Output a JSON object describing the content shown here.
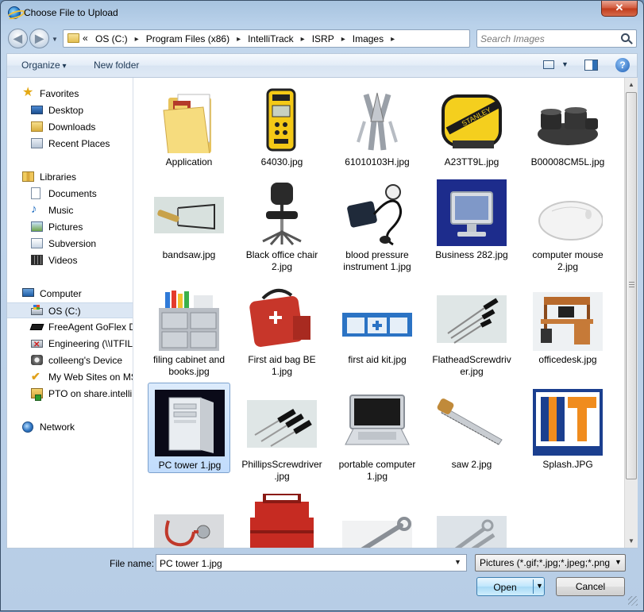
{
  "window": {
    "title": "Choose File to Upload",
    "close_label": "✕"
  },
  "nav": {
    "back_label": "◀",
    "forward_label": "▶",
    "refresh_label": "⟲"
  },
  "address": {
    "lead": "«",
    "crumbs": [
      "OS (C:)",
      "Program Files (x86)",
      "IntelliTrack",
      "ISRP",
      "Images"
    ],
    "separator": "▸"
  },
  "search": {
    "placeholder": "Search Images",
    "value": ""
  },
  "toolbar": {
    "organize_label": "Organize",
    "new_folder_label": "New folder",
    "help_label": "?"
  },
  "sidebar": {
    "groups": [
      {
        "label": "Favorites",
        "icon": "star-icon",
        "items": [
          {
            "label": "Desktop",
            "icon": "desktop-icon"
          },
          {
            "label": "Downloads",
            "icon": "downloads-folder-icon"
          },
          {
            "label": "Recent Places",
            "icon": "recent-places-icon"
          }
        ]
      },
      {
        "label": "Libraries",
        "icon": "libraries-icon",
        "items": [
          {
            "label": "Documents",
            "icon": "documents-icon"
          },
          {
            "label": "Music",
            "icon": "music-icon"
          },
          {
            "label": "Pictures",
            "icon": "pictures-icon"
          },
          {
            "label": "Subversion",
            "icon": "subversion-icon"
          },
          {
            "label": "Videos",
            "icon": "videos-icon"
          }
        ]
      },
      {
        "label": "Computer",
        "icon": "computer-icon",
        "items": [
          {
            "label": "OS (C:)",
            "icon": "drive-icon",
            "selected": true
          },
          {
            "label": "FreeAgent GoFlex Dr",
            "icon": "external-drive-icon"
          },
          {
            "label": "Engineering (\\\\ITFIL",
            "icon": "disconnected-network-drive-icon"
          },
          {
            "label": "colleeng's Device",
            "icon": "device-icon"
          },
          {
            "label": "My Web Sites on MS",
            "icon": "web-sites-icon"
          },
          {
            "label": "PTO on share.intelli",
            "icon": "network-folder-icon"
          }
        ]
      },
      {
        "label": "Network",
        "icon": "network-icon",
        "items": []
      }
    ]
  },
  "files": [
    {
      "name": "Application",
      "kind": "folder"
    },
    {
      "name": "64030.jpg",
      "kind": "yellow-tape-measure"
    },
    {
      "name": "61010103H.jpg",
      "kind": "multitool"
    },
    {
      "name": "A23TT9L.jpg",
      "kind": "tape-measure"
    },
    {
      "name": "B00008CM5L.jpg",
      "kind": "cookware"
    },
    {
      "name": "bandsaw.jpg",
      "kind": "bandsaw"
    },
    {
      "name": "Black office chair 2.jpg",
      "kind": "chair"
    },
    {
      "name": "blood pressure instrument 1.jpg",
      "kind": "blood-pressure"
    },
    {
      "name": "Business 282.jpg",
      "kind": "monitor"
    },
    {
      "name": "computer mouse 2.jpg",
      "kind": "mouse"
    },
    {
      "name": "filing cabinet and books.jpg",
      "kind": "filing-cabinet"
    },
    {
      "name": "First aid bag BE 1.jpg",
      "kind": "first-aid-bag"
    },
    {
      "name": "first aid kit.jpg",
      "kind": "first-aid-kit"
    },
    {
      "name": "FlatheadScrewdriver.jpg",
      "kind": "screwdrivers"
    },
    {
      "name": "officedesk.jpg",
      "kind": "desk"
    },
    {
      "name": "PC tower 1.jpg",
      "kind": "pc-tower",
      "selected": true
    },
    {
      "name": "PhillipsScrewdriver.jpg",
      "kind": "screwdrivers-black"
    },
    {
      "name": "portable computer 1.jpg",
      "kind": "laptop"
    },
    {
      "name": "saw 2.jpg",
      "kind": "handsaw"
    },
    {
      "name": "Splash.JPG",
      "kind": "splash-logo"
    },
    {
      "name": "",
      "kind": "stethoscope"
    },
    {
      "name": "",
      "kind": "toolbox"
    },
    {
      "name": "",
      "kind": "wrench"
    },
    {
      "name": "",
      "kind": "wrenches"
    }
  ],
  "bottom": {
    "file_name_label": "File name:",
    "file_name_value": "PC tower 1.jpg",
    "file_type_value": "Pictures (*.gif;*.jpg;*.jpeg;*.png",
    "open_label": "Open",
    "cancel_label": "Cancel"
  },
  "colors": {
    "accent": "#3c7fb1",
    "selection": "#c1dcfc",
    "titlebar": "#b9d1ea",
    "close": "#c03a1b"
  }
}
